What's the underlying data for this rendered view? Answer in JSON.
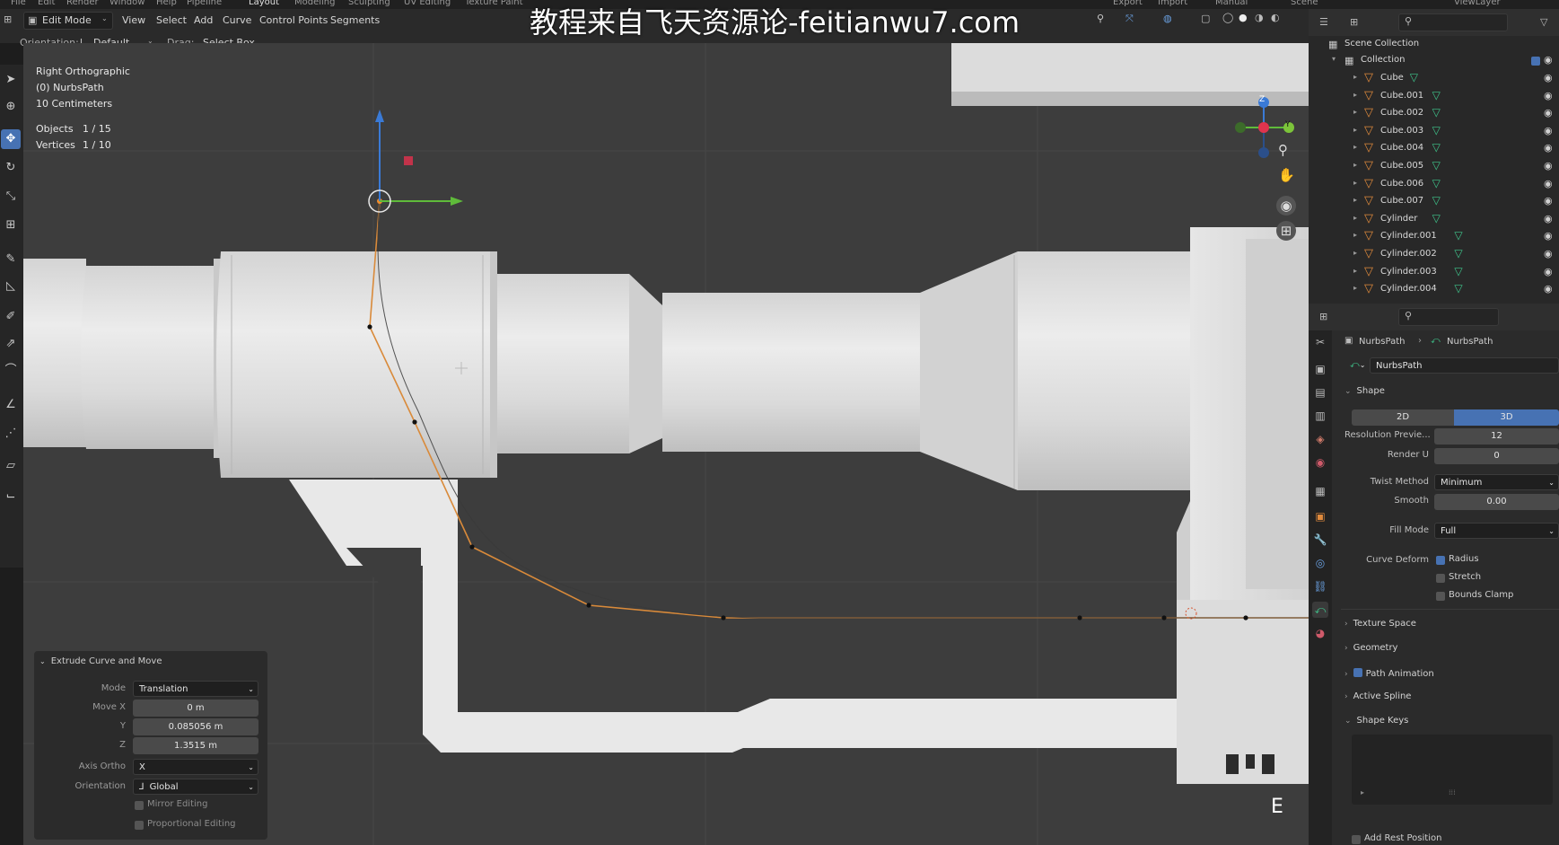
{
  "watermark": "教程来自飞天资源论-feitianwu7.com",
  "menubar": {
    "items": [
      "File",
      "Edit",
      "Render",
      "Window",
      "Help",
      "Pipeline"
    ],
    "workspace_tabs": [
      "Layout",
      "Modeling",
      "Sculpting",
      "UV Editing",
      "Texture Paint"
    ],
    "right_items": [
      "Export",
      "Import",
      "Manual",
      "Scene",
      "ViewLayer"
    ]
  },
  "header": {
    "mode": "Edit Mode",
    "menus": [
      "View",
      "Select",
      "Add",
      "Curve",
      "Control Points",
      "Segments"
    ],
    "orientation_label": "Orientation:",
    "orientation_value": "Default",
    "drag_label": "Drag:",
    "drag_value": "Select Box"
  },
  "viewport": {
    "view_name": "Right Orthographic",
    "object_line": "(0) NurbsPath",
    "scale_line": "10 Centimeters",
    "objects_label": "Objects",
    "objects_value": "1 / 15",
    "vertices_label": "Vertices",
    "vertices_value": "1 / 10",
    "key_overlay": "E",
    "gizmo_axes": {
      "z": "Z",
      "y": "Y"
    }
  },
  "redo_panel": {
    "title": "Extrude Curve and Move",
    "mode_label": "Mode",
    "mode_value": "Translation",
    "move_x_label": "Move X",
    "move_x_value": "0 m",
    "y_label": "Y",
    "y_value": "0.085056 m",
    "z_label": "Z",
    "z_value": "1.3515 m",
    "axis_ortho_label": "Axis Ortho",
    "axis_ortho_value": "X",
    "orientation_label": "Orientation",
    "orientation_value": "Global",
    "mirror_label": "Mirror Editing",
    "proportional_label": "Proportional Editing"
  },
  "outliner": {
    "scene_collection": "Scene Collection",
    "collection": "Collection",
    "items": [
      "Cube",
      "Cube.001",
      "Cube.002",
      "Cube.003",
      "Cube.004",
      "Cube.005",
      "Cube.006",
      "Cube.007",
      "Cylinder",
      "Cylinder.001",
      "Cylinder.002",
      "Cylinder.003",
      "Cylinder.004"
    ]
  },
  "properties": {
    "breadcrumb_object": "NurbsPath",
    "breadcrumb_data": "NurbsPath",
    "datablock_name": "NurbsPath",
    "shape_section": "Shape",
    "dim_2d": "2D",
    "dim_3d": "3D",
    "resolution_preview_label": "Resolution Previe...",
    "resolution_preview_value": "12",
    "render_u_label": "Render U",
    "render_u_value": "0",
    "twist_method_label": "Twist Method",
    "twist_method_value": "Minimum",
    "smooth_label": "Smooth",
    "smooth_value": "0.00",
    "fill_mode_label": "Fill Mode",
    "fill_mode_value": "Full",
    "curve_deform_label": "Curve Deform",
    "radius_label": "Radius",
    "stretch_label": "Stretch",
    "bounds_clamp_label": "Bounds Clamp",
    "texture_space": "Texture Space",
    "geometry": "Geometry",
    "path_animation": "Path Animation",
    "active_spline": "Active Spline",
    "shape_keys": "Shape Keys",
    "add_rest_position": "Add Rest Position"
  },
  "colors": {
    "accent_blue": "#4772b3",
    "curve_orange": "#d98a3a",
    "object_orange": "#e08a3c",
    "mesh_green": "#3fc48b"
  }
}
